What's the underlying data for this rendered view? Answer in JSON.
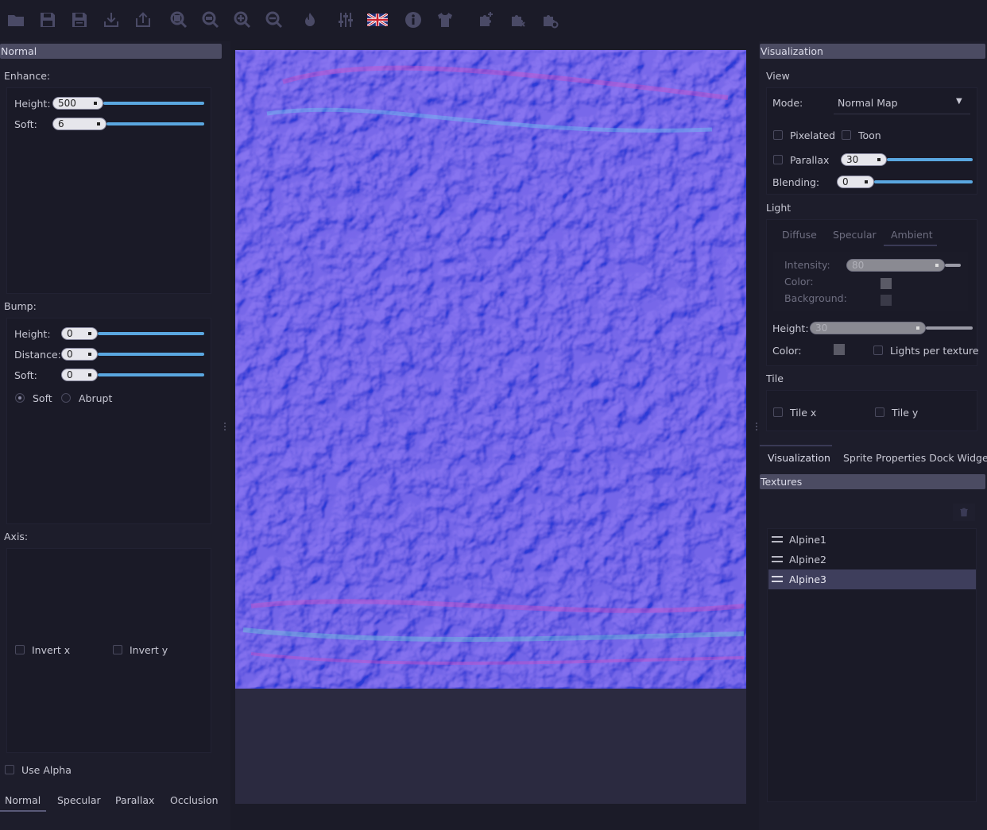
{
  "toolbar": {
    "icons": [
      "folder-open-icon",
      "save-icon",
      "save-as-icon",
      "export-icon",
      "share-icon",
      "zoom-fit-icon",
      "zoom-100-icon",
      "zoom-in-icon",
      "zoom-out-icon",
      "light-icon",
      "settings-icon",
      "language-flag-icon",
      "info-icon",
      "shirt-icon",
      "puzzle-add-icon",
      "puzzle-remove-icon",
      "puzzle-refresh-icon"
    ]
  },
  "left": {
    "title": "Normal",
    "enhance": {
      "label": "Enhance:",
      "height_label": "Height:",
      "height_value": "500",
      "soft_label": "Soft:",
      "soft_value": "6"
    },
    "bump": {
      "label": "Bump:",
      "height_label": "Height:",
      "height_value": "0",
      "distance_label": "Distance:",
      "distance_value": "0",
      "soft_label": "Soft:",
      "soft_value": "0",
      "radio_soft": "Soft",
      "radio_abrupt": "Abrupt"
    },
    "axis": {
      "label": "Axis:",
      "invert_x": "Invert x",
      "invert_y": "Invert y"
    },
    "use_alpha": "Use Alpha",
    "tabs": [
      "Normal",
      "Specular",
      "Parallax",
      "Occlusion"
    ],
    "active_tab": "Normal"
  },
  "right": {
    "title": "Visualization",
    "view": {
      "label": "View",
      "mode_label": "Mode:",
      "mode_value": "Normal Map",
      "pixelated": "Pixelated",
      "toon": "Toon",
      "parallax": "Parallax",
      "parallax_value": "30",
      "blending_label": "Blending:",
      "blending_value": "0"
    },
    "light": {
      "label": "Light",
      "tabs": [
        "Diffuse",
        "Specular",
        "Ambient"
      ],
      "active_tab": "Ambient",
      "intensity_label": "Intensity:",
      "intensity_value": "80",
      "color_label": "Color:",
      "background_label": "Background:",
      "height_label": "Height:",
      "height_value": "30",
      "color2_label": "Color:",
      "lights_per_texture": "Lights per texture"
    },
    "tile": {
      "label": "Tile",
      "tile_x": "Tile x",
      "tile_y": "Tile y"
    },
    "dock_tabs": [
      "Visualization",
      "Sprite Properties Dock Widget"
    ],
    "textures": {
      "title": "Textures",
      "items": [
        "Alpine1",
        "Alpine2",
        "Alpine3"
      ],
      "selected": "Alpine3"
    }
  },
  "colors": {
    "accent": "#5aa7e0",
    "header": "#4b4b62",
    "normal_map": "#8080ff"
  }
}
